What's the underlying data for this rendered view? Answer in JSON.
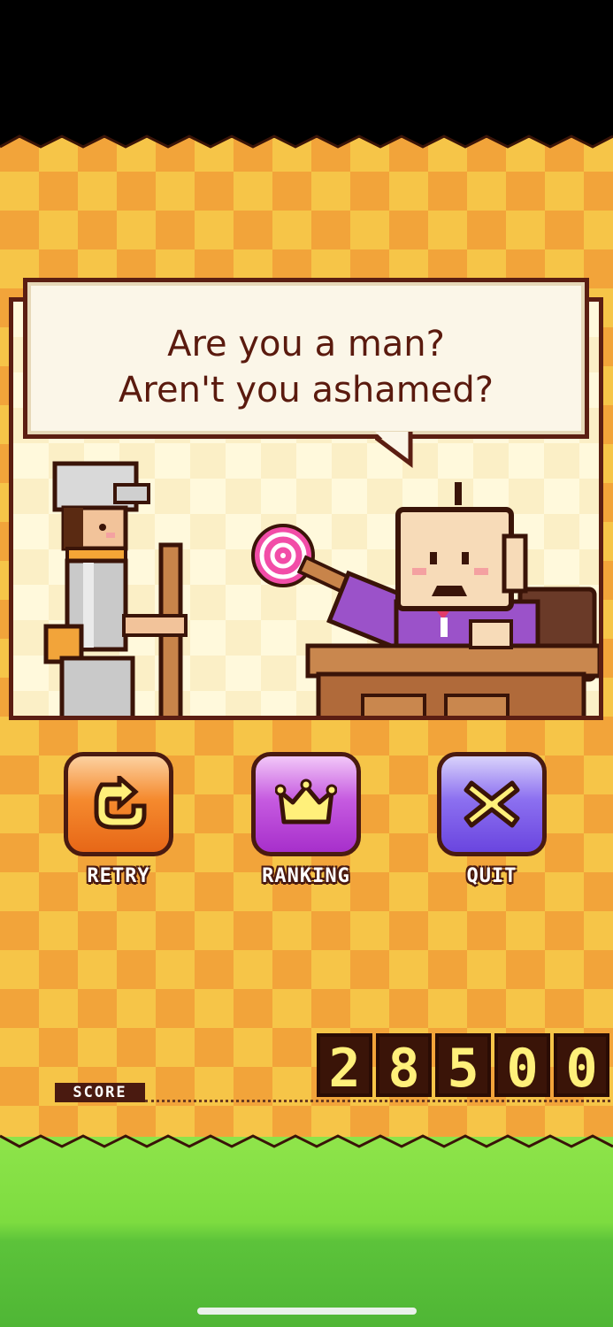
{
  "dialog": {
    "line1": "Are you a man?",
    "line2": "Aren't you ashamed?"
  },
  "buttons": {
    "retry": {
      "label": "RETRY",
      "icon": "retry-arrow-icon"
    },
    "ranking": {
      "label": "RANKING",
      "icon": "crown-icon"
    },
    "quit": {
      "label": "QUIT",
      "icon": "x-icon"
    }
  },
  "score": {
    "label": "SCORE",
    "digits": [
      "2",
      "8",
      "5",
      "0",
      "0"
    ]
  },
  "colors": {
    "checker_light": "#f6c548",
    "checker_dark": "#f2a43a",
    "outline": "#5b1e12",
    "score_digit": "#fff07a"
  }
}
